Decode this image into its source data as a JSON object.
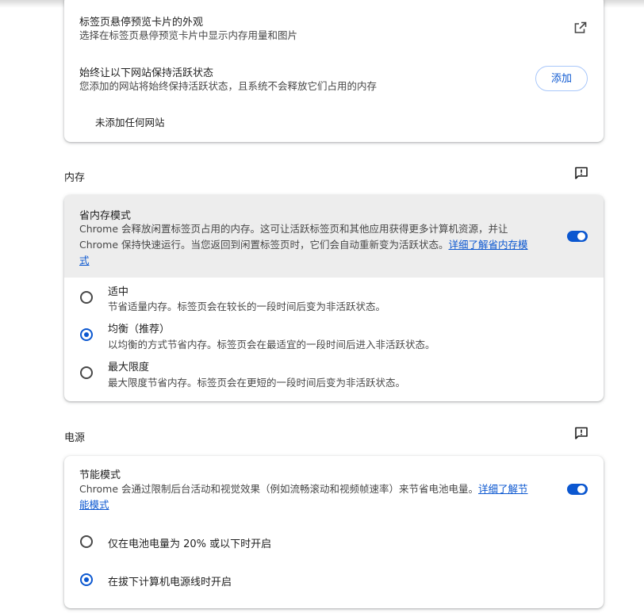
{
  "tab_section": {
    "hover_card": {
      "title": "标签页悬停预览卡片的外观",
      "desc": "选择在标签页悬停预览卡片中显示内存用量和图片",
      "icon": "open-in-new-icon"
    },
    "always_active": {
      "title": "始终让以下网站保持活跃状态",
      "desc": "您添加的网站将始终保持活跃状态，且系统不会释放它们占用的内存",
      "add_label": "添加",
      "empty_text": "未添加任何网站"
    }
  },
  "memory": {
    "header": "内存",
    "saver": {
      "title": "省内存模式",
      "desc_line1": "Chrome 会释放闲置标签页占用的内存。这可让活跃标签页和其他应用获得更多计算机资源，并让",
      "desc_line2_text": "Chrome 保持快速运行。当您返回到闲置标签页时，它们会自动重新变为活跃状态。",
      "desc_line2_link": "详细了解省内存模",
      "desc_line3_link": "式",
      "enabled": true
    },
    "options": [
      {
        "title": "适中",
        "desc": "节省适量内存。标签页会在较长的一段时间后变为非活跃状态。",
        "selected": false
      },
      {
        "title": "均衡（推荐）",
        "desc": "以均衡的方式节省内存。标签页会在最适宜的一段时间后进入非活跃状态。",
        "selected": true
      },
      {
        "title": "最大限度",
        "desc": "最大限度节省内存。标签页会在更短的一段时间后变为非活跃状态。",
        "selected": false
      }
    ]
  },
  "power": {
    "header": "电源",
    "saver": {
      "title": "节能模式",
      "desc_line1_text": "Chrome 会通过限制后台活动和视觉效果（例如流畅滚动和视频帧速率）来节省电池电量。",
      "desc_line1_link": "详细了解节",
      "desc_line2_link": "能模式",
      "enabled": true
    },
    "options": [
      {
        "title": "仅在电池电量为 20% 或以下时开启",
        "selected": false
      },
      {
        "title": "在拔下计算机电源线时开启",
        "selected": true
      }
    ]
  },
  "colors": {
    "accent": "#0b57d0",
    "highlight_bg": "#ededed"
  }
}
